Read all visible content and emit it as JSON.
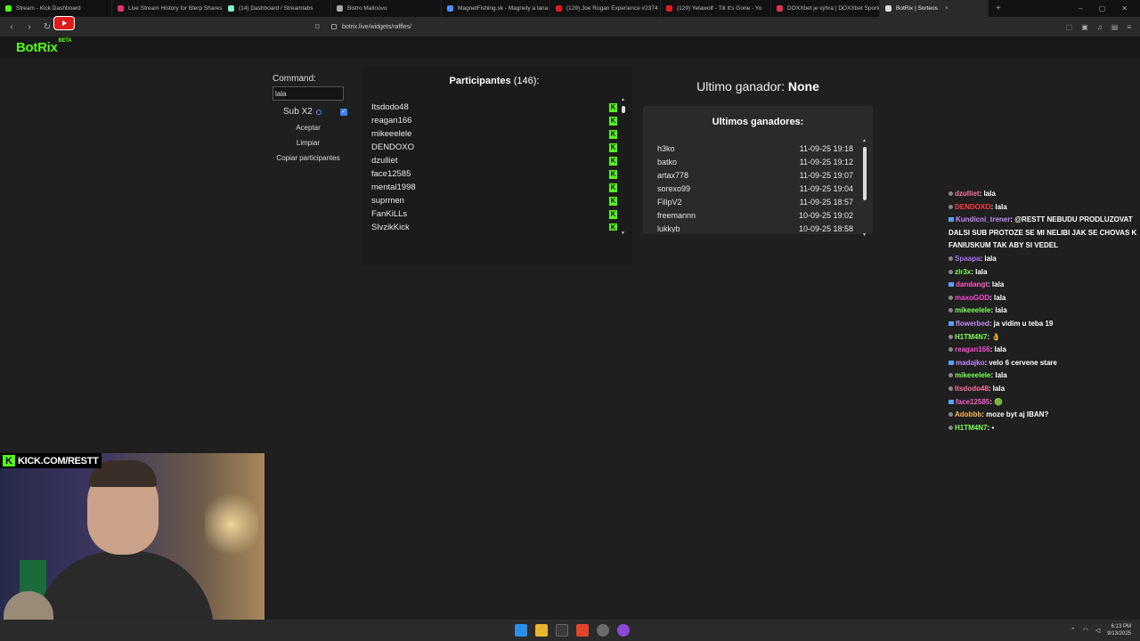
{
  "browser": {
    "tabs": [
      {
        "label": "Stream - Kick Dashboard",
        "color": "#53fc18",
        "active": false
      },
      {
        "label": "Live Stream History for Blerp Shares",
        "color": "#e0336b",
        "active": false
      },
      {
        "label": "(14) Dashboard / Streamlabs",
        "color": "#80f5d2",
        "active": false
      },
      {
        "label": "Bistro Malinovo",
        "color": "#aaaaaa",
        "active": false
      },
      {
        "label": "MagnetFishing.sk - Magnety a lana p",
        "color": "#4a90ff",
        "active": false
      },
      {
        "label": "(129) Joe Rogan Experience #2374 -",
        "color": "#e01b1b",
        "active": false
      },
      {
        "label": "(129) Yelawolf - Till It's Gone - Yo",
        "color": "#e01b1b",
        "active": false
      },
      {
        "label": "DOXXbet je výhra | DOXXbet Sportov",
        "color": "#e0334b",
        "active": false
      },
      {
        "label": "BotRix | Sorteos",
        "color": "#dddddd",
        "active": true
      }
    ],
    "url": "botrix.live/widgets/raffles/",
    "new_tab": "+"
  },
  "page": {
    "logo": "BotRix",
    "logo_sup": "BETA",
    "command_label": "Command:",
    "command_value": "lala",
    "sub_label": "Sub X2",
    "buttons": {
      "accept": "Aceptar",
      "clear": "Limpiar",
      "copy": "Copiar participantes"
    },
    "participants_title": "Participantes",
    "participants_count": "(146):",
    "participants": [
      "Itsdodo48",
      "reagan166",
      "mikeeelele",
      "DENDOXO",
      "dzulliet",
      "face12585",
      "mental1998",
      "suprmen",
      "FanKiLLs",
      "SlvzikKick"
    ],
    "last_winner_label": "Ultimo ganador:",
    "last_winner_value": "None",
    "winners_title": "Ultimos ganadores:",
    "winners": [
      {
        "name": "h3ko",
        "time": "11-09-25 19:18"
      },
      {
        "name": "batko",
        "time": "11-09-25 19:12"
      },
      {
        "name": "artax778",
        "time": "11-09-25 19:07"
      },
      {
        "name": "sorexo99",
        "time": "11-09-25 19:04"
      },
      {
        "name": "FilipV2",
        "time": "11-09-25 18:57"
      },
      {
        "name": "freemannn",
        "time": "10-09-25 19:02"
      },
      {
        "name": "lukkyb",
        "time": "10-09-25 18:58"
      }
    ]
  },
  "chat": [
    {
      "user": "dzulliet",
      "color": "#ff6ea0",
      "msg": "lala"
    },
    {
      "user": "DENDOXO",
      "color": "#ff3b3b",
      "msg": "lala"
    },
    {
      "user": "Kundicni_trener",
      "color": "#c48bff",
      "msg": "@RESTT NEBUDU PRODLUZOVAT DALSI SUB PROTOZE SE MI NELIBI JAK SE CHOVAS K FANIUSKUM TAK ABY SI VEDEL"
    },
    {
      "user": "Spaapa",
      "color": "#b06cff",
      "msg": "lala"
    },
    {
      "user": "zlr3x",
      "color": "#7dff5a",
      "msg": "lala"
    },
    {
      "user": "dandangt",
      "color": "#ff5ac8",
      "msg": "lala"
    },
    {
      "user": "maxoGOD",
      "color": "#ff4ad8",
      "msg": "lala"
    },
    {
      "user": "mikeeelele",
      "color": "#7dff5a",
      "msg": "lala"
    },
    {
      "user": "flowerbed",
      "color": "#c48bff",
      "msg": "ja vidim u teba 19"
    },
    {
      "user": "H1TM4N7",
      "color": "#7dff5a",
      "msg": "👌"
    },
    {
      "user": "reagan166",
      "color": "#ff4ad8",
      "msg": "lala"
    },
    {
      "user": "madajko",
      "color": "#c48bff",
      "msg": "velo 6 cervene stare"
    },
    {
      "user": "mikeeelele",
      "color": "#7dff5a",
      "msg": "lala"
    },
    {
      "user": "Itsdodo48",
      "color": "#ff6ea0",
      "msg": "lala"
    },
    {
      "user": "face12585",
      "color": "#ff5ac8",
      "msg": "🟢"
    },
    {
      "user": "Adobbb",
      "color": "#ffb84a",
      "msg": "moze byt aj IBAN?"
    },
    {
      "user": "H1TM4N7",
      "color": "#7dff5a",
      "msg": "▪"
    }
  ],
  "overlay": {
    "kick_banner": "KICK.COM/RESTT",
    "kick_letter": "K"
  },
  "taskbar": {
    "time": "6:13 PM",
    "date": "9/13/2025"
  }
}
